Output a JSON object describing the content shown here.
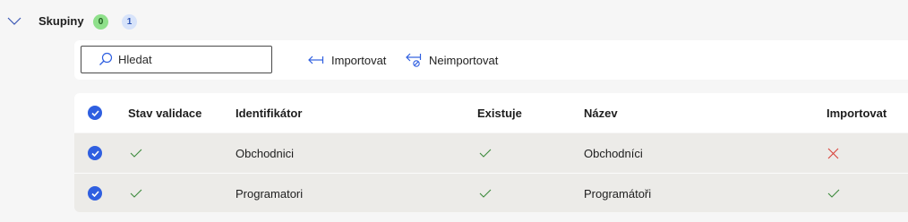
{
  "section": {
    "title": "Skupiny",
    "badge_green": "0",
    "badge_blue": "1"
  },
  "toolbar": {
    "search_placeholder": "Hledat",
    "import_label": "Importovat",
    "noimport_label": "Neimportovat"
  },
  "table": {
    "headers": {
      "validation": "Stav validace",
      "identifier": "Identifikátor",
      "exists": "Existuje",
      "name": "Název",
      "import": "Importovat"
    },
    "rows": [
      {
        "identifier": "Obchodnici",
        "name": "Obchodníci",
        "validation": "ok",
        "exists": "yes",
        "import": "no"
      },
      {
        "identifier": "Programatori",
        "name": "Programátoři",
        "validation": "ok",
        "exists": "yes",
        "import": "yes"
      }
    ]
  },
  "colors": {
    "accent": "#2f5fe0",
    "check_green": "#3c8a3c",
    "cross_red": "#d8423a"
  }
}
